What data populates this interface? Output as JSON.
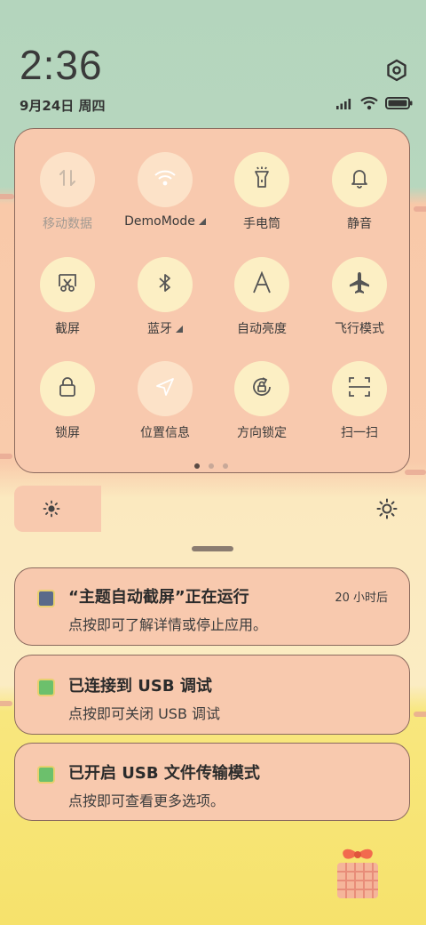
{
  "status_bar": {
    "time": "2:36",
    "date": "9月24日 周四"
  },
  "quick_settings": {
    "tiles": [
      {
        "label": "移动数据",
        "icon": "mobile-data-icon",
        "active": false
      },
      {
        "label": "DemoMode",
        "icon": "wifi-icon",
        "active": false,
        "has_more": true
      },
      {
        "label": "手电筒",
        "icon": "flashlight-icon",
        "active": true
      },
      {
        "label": "静音",
        "icon": "bell-icon",
        "active": true
      },
      {
        "label": "截屏",
        "icon": "screenshot-icon",
        "active": true
      },
      {
        "label": "蓝牙",
        "icon": "bluetooth-icon",
        "active": true,
        "has_more": true
      },
      {
        "label": "自动亮度",
        "icon": "auto-brightness-icon",
        "active": true
      },
      {
        "label": "飞行模式",
        "icon": "airplane-icon",
        "active": true
      },
      {
        "label": "锁屏",
        "icon": "lock-icon",
        "active": true
      },
      {
        "label": "位置信息",
        "icon": "location-icon",
        "active": false
      },
      {
        "label": "方向锁定",
        "icon": "rotation-lock-icon",
        "active": true
      },
      {
        "label": "扫一扫",
        "icon": "scan-icon",
        "active": true
      }
    ],
    "pager": {
      "pages": 3,
      "current": 1
    },
    "brightness_level": 0.22
  },
  "notifications": [
    {
      "title": "“主题自动截屏”正在运行",
      "body": "点按即可了解详情或停止应用。",
      "time": "20 小时后"
    },
    {
      "title": "已连接到 USB 调试",
      "body": "点按即可关闭 USB 调试"
    },
    {
      "title": "已开启 USB 文件传输模式",
      "body": "点按即可查看更多选项。"
    }
  ],
  "colors": {
    "panel": "#f8c9ae",
    "tile_active": "#fcefc4",
    "text": "#3a3a3a"
  }
}
